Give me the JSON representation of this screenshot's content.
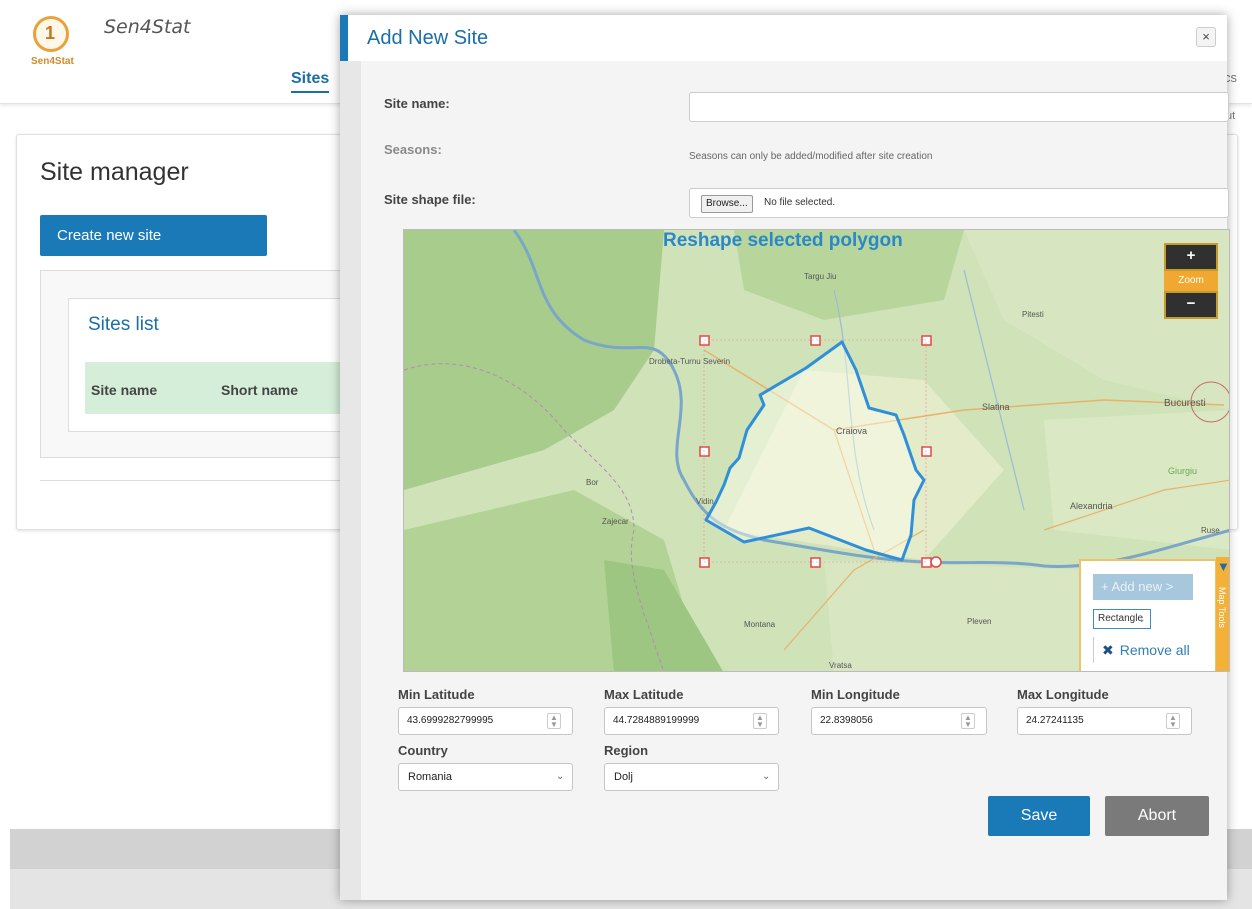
{
  "app": {
    "brand": "Sen4Stat",
    "logo_text": "Sen4Stat",
    "nav_active": "Sites",
    "nav_right_partial": "cs",
    "nav_right_partial_2": "ut"
  },
  "background": {
    "page_title": "Site manager",
    "create_button": "Create new site",
    "list_title": "Sites list",
    "table_columns": [
      "Site name",
      "Short name"
    ]
  },
  "modal": {
    "title": "Add New Site",
    "close_label": "×",
    "site_name_label": "Site name:",
    "site_name_value": "",
    "seasons_label": "Seasons:",
    "seasons_note": "Seasons can only be added/modified after site creation",
    "shape_file_label": "Site shape file:",
    "browse_label": "Browse...",
    "file_status": "No file selected.",
    "map": {
      "overlay_title": "Reshape selected polygon",
      "zoom_in": "+",
      "zoom_label": "Zoom",
      "zoom_out": "−",
      "tools_tab": "Map Tools",
      "add_new": "+ Add new >",
      "shape_type": "Rectangle",
      "remove_all": "Remove all",
      "place_labels": [
        "Craiova",
        "Slatina",
        "Bucuresti",
        "Alexandria",
        "Giurgiu",
        "Drobeta-Turnu Severin",
        "Targu Jiu",
        "Vidin",
        "Montana",
        "Pleven",
        "Vratsa",
        "Zajecar",
        "Bor",
        "Ruse",
        "Pitesti"
      ]
    },
    "fields": {
      "min_lat_label": "Min Latitude",
      "min_lat_value": "43.6999282799995",
      "max_lat_label": "Max Latitude",
      "max_lat_value": "44.7284889199999",
      "min_lon_label": "Min Longitude",
      "min_lon_value": "22.8398056",
      "max_lon_label": "Max Longitude",
      "max_lon_value": "24.27241135",
      "country_label": "Country",
      "country_value": "Romania",
      "region_label": "Region",
      "region_value": "Dolj"
    },
    "save_label": "Save",
    "abort_label": "Abort"
  }
}
